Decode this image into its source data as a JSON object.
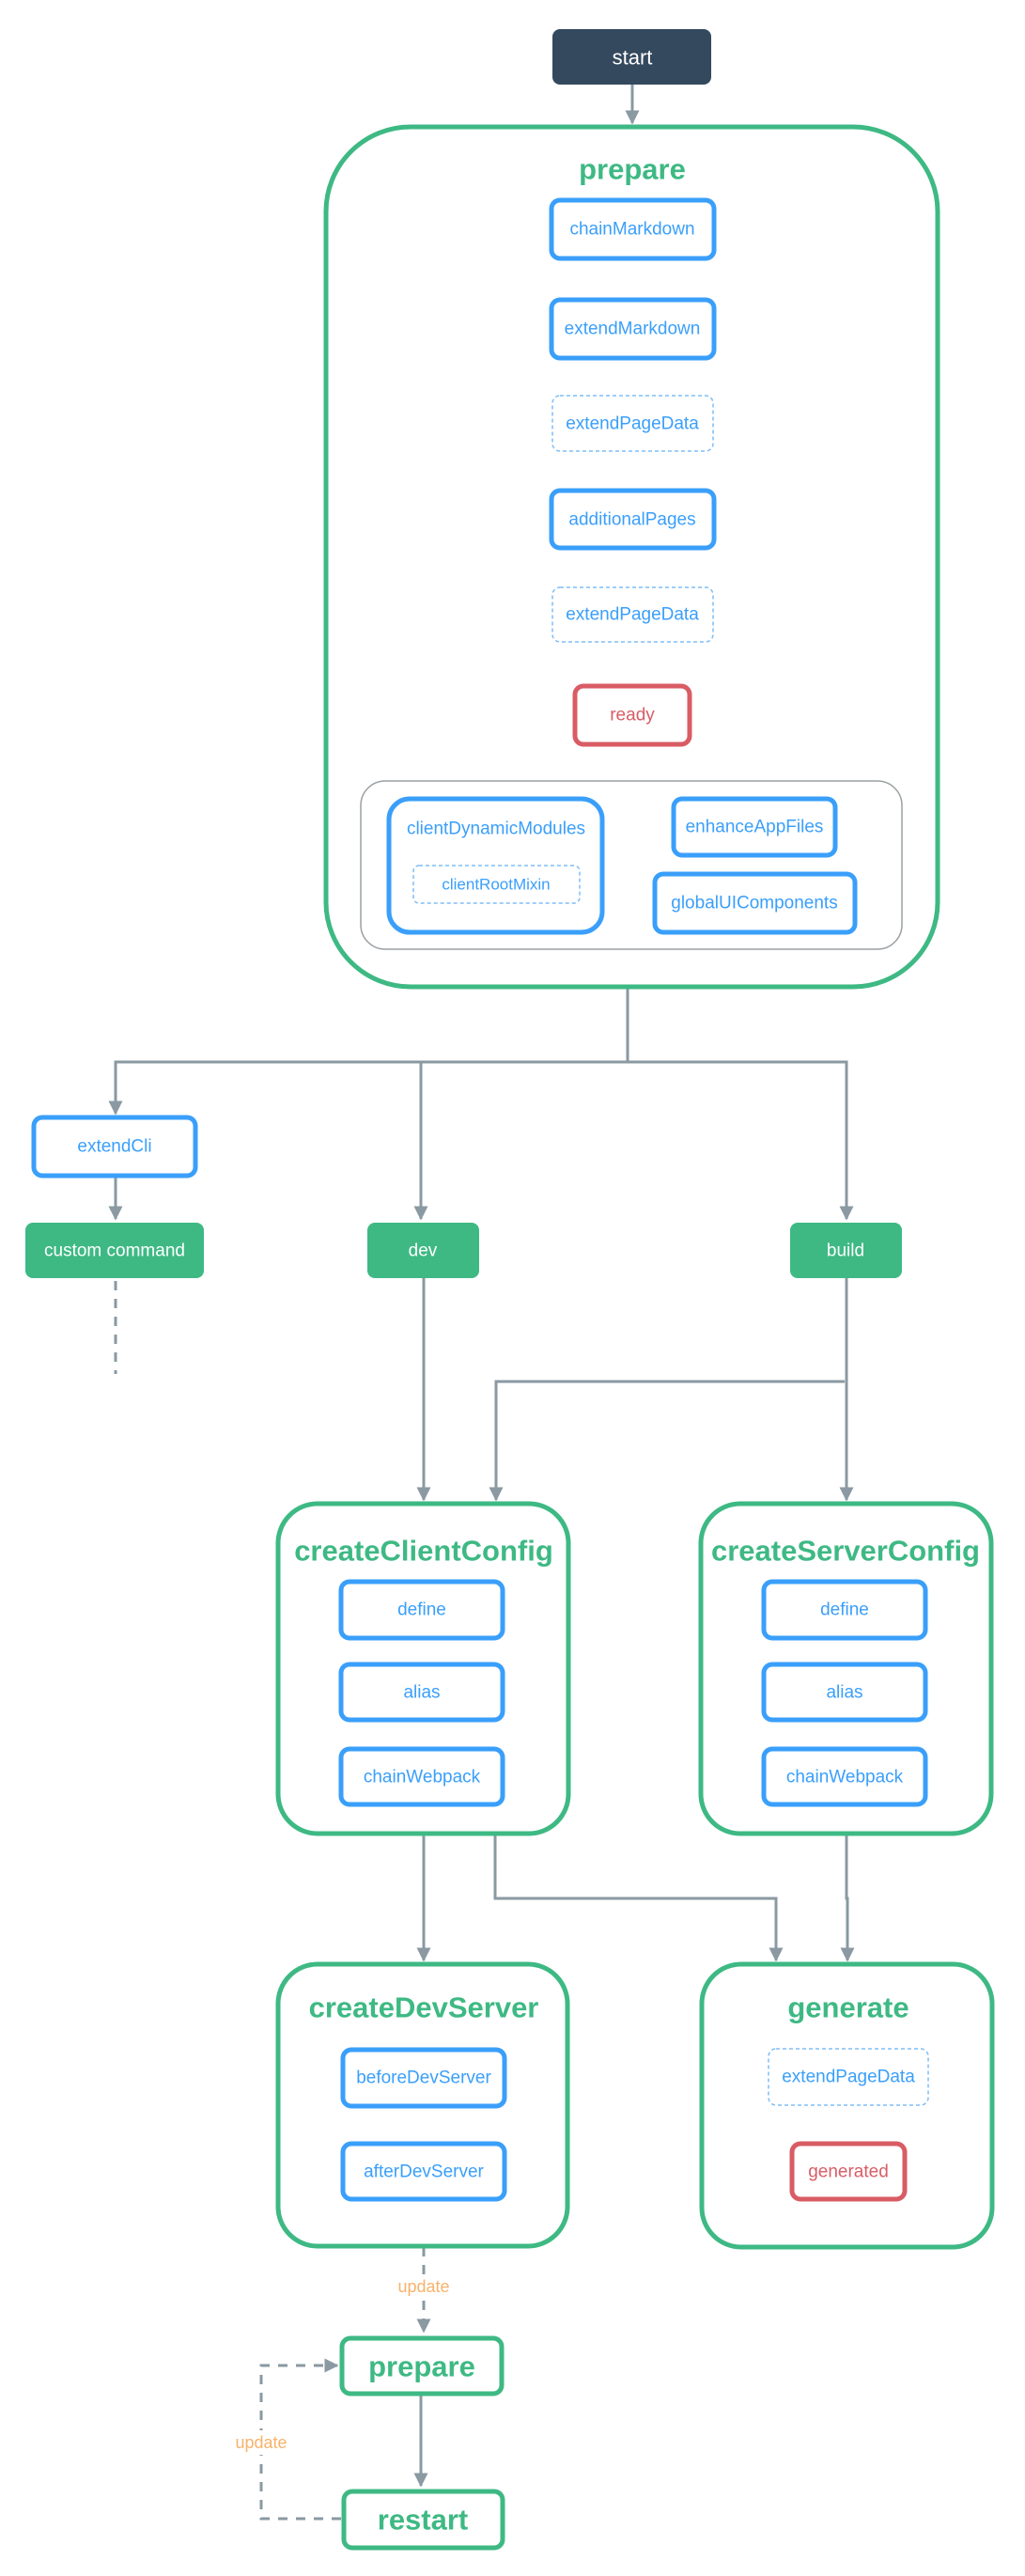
{
  "diagram": {
    "start": "start",
    "prepare": {
      "title": "prepare",
      "steps": [
        "chainMarkdown",
        "extendMarkdown",
        "extendPageData",
        "additionalPages",
        "extendPageData",
        "ready"
      ],
      "group": {
        "clientDynamicModules": "clientDynamicModules",
        "clientRootMixin": "clientRootMixin",
        "enhanceAppFiles": "enhanceAppFiles",
        "globalUIComponents": "globalUIComponents"
      }
    },
    "branches": {
      "extendCli": "extendCli",
      "custom_command": "custom command",
      "dev": "dev",
      "build": "build"
    },
    "createClientConfig": {
      "title": "createClientConfig",
      "hooks": [
        "define",
        "alias",
        "chainWebpack"
      ]
    },
    "createServerConfig": {
      "title": "createServerConfig",
      "hooks": [
        "define",
        "alias",
        "chainWebpack"
      ]
    },
    "createDevServer": {
      "title": "createDevServer",
      "hooks": [
        "beforeDevServer",
        "afterDevServer"
      ]
    },
    "generate": {
      "title": "generate",
      "hooks": [
        "extendPageData",
        "generated"
      ]
    },
    "loop": {
      "prepare": "prepare",
      "restart": "restart",
      "update_label_1": "update",
      "update_label_2": "update"
    }
  },
  "colors": {
    "stage_green": "#3eb984",
    "hook_blue": "#3a9ffa",
    "lifecycle_red": "#d95c65",
    "start_dark": "#34495e",
    "edge_gray": "#8a99a2",
    "update_orange": "#f8b26a"
  }
}
